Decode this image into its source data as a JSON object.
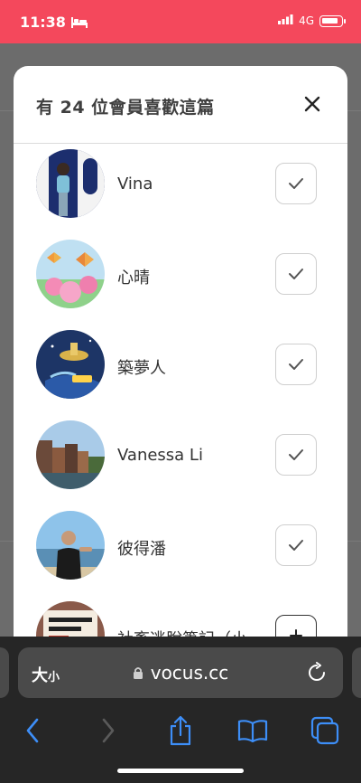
{
  "status": {
    "time": "11:38",
    "network": "4G"
  },
  "modal": {
    "title": "有 24 位會員喜歡這篇"
  },
  "members": [
    {
      "name": "Vina",
      "following": true
    },
    {
      "name": "心晴",
      "following": true
    },
    {
      "name": "築夢人",
      "following": true
    },
    {
      "name": "Vanessa Li",
      "following": true
    },
    {
      "name": "彼得潘",
      "following": true
    },
    {
      "name": "社畜逃脫筆記（小",
      "following": false
    }
  ],
  "browser": {
    "text_size_big": "大",
    "text_size_small": "小",
    "url": "vocus.cc"
  },
  "colors": {
    "status_bar": "#f4485c",
    "toolbar_icon": "#3d8ef7"
  }
}
